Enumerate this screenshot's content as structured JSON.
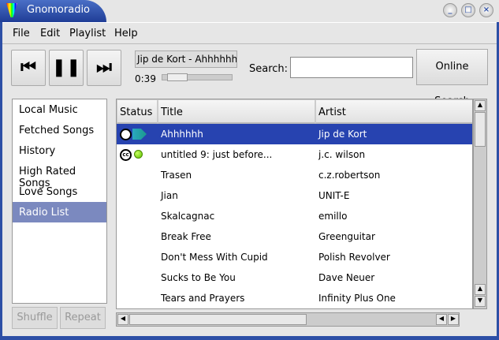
{
  "window": {
    "title": "Gnomoradio",
    "controls": [
      "minimize",
      "maximize",
      "close"
    ]
  },
  "menu": [
    "File",
    "Edit",
    "Playlist",
    "Help"
  ],
  "toolbar": {
    "prev_icon": "skip-back-icon",
    "pause_icon": "pause-icon",
    "next_icon": "skip-forward-icon",
    "now_playing": "Jip de Kort - Ahhhhhh",
    "time": "0:39",
    "progress_percent": 10,
    "search_label": "Search:",
    "search_value": "",
    "online_search": "Online Search"
  },
  "sidebar": {
    "items": [
      "Local Music",
      "Fetched Songs",
      "History",
      "High Rated Songs",
      "Love Songs",
      "Radio List"
    ],
    "selected": "Radio List",
    "shuffle": "Shuffle",
    "repeat": "Repeat"
  },
  "table": {
    "columns": [
      "Status",
      "Title",
      "Artist"
    ],
    "rows": [
      {
        "status": "cc-playing",
        "title": "Ahhhhhh",
        "artist": "Jip de Kort",
        "selected": true
      },
      {
        "status": "cc-green",
        "title": "untitled 9: just before...",
        "artist": "j.c. wilson"
      },
      {
        "status": "",
        "title": "Trasen",
        "artist": "c.z.robertson"
      },
      {
        "status": "",
        "title": "Jian",
        "artist": "UNIT-E"
      },
      {
        "status": "",
        "title": "Skalcagnac",
        "artist": "emillo"
      },
      {
        "status": "",
        "title": "Break Free",
        "artist": "Greenguitar"
      },
      {
        "status": "",
        "title": "Don't Mess With Cupid",
        "artist": "Polish Revolver"
      },
      {
        "status": "",
        "title": "Sucks to Be You",
        "artist": "Dave Neuer"
      },
      {
        "status": "",
        "title": "Tears and Prayers",
        "artist": "Infinity Plus One"
      }
    ]
  },
  "colors": {
    "selection": "#2743b0",
    "sidebar_selection": "#7b89bf",
    "frame": "#2d4fa6"
  }
}
